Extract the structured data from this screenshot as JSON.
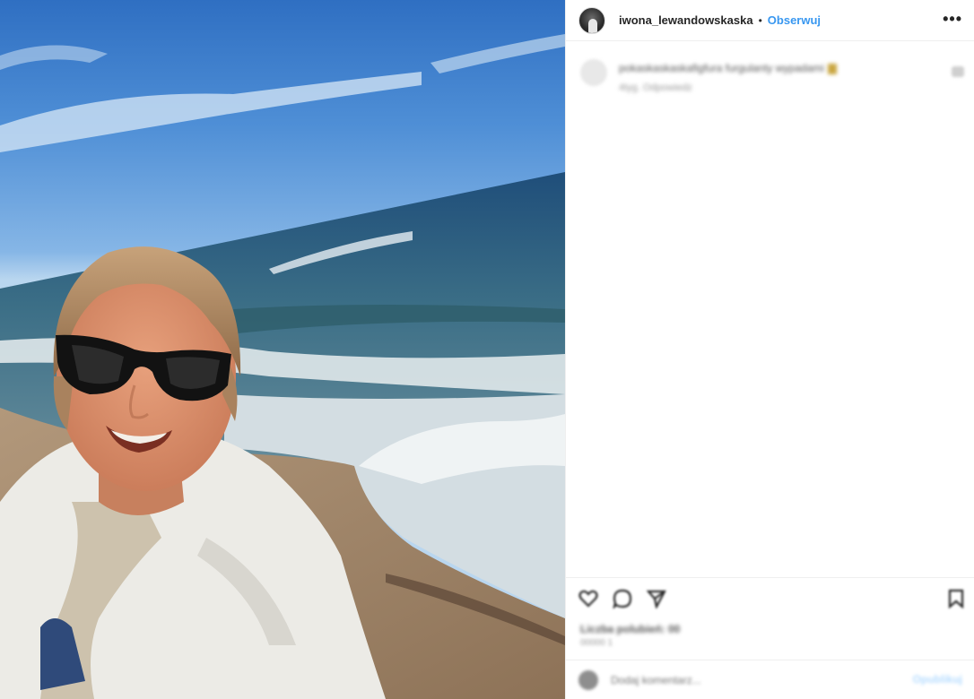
{
  "post": {
    "username": "iwona_lewandowskaska",
    "separator": "•",
    "follow_label": "Obserwuj",
    "more_label": "•••",
    "caption": {
      "text": "pokaskaskaskafigfura furgulanty wypadami",
      "meta": "4tyg.   Odpowiedz"
    },
    "likes_text": "Liczba polubień: 00",
    "date_text": "00000 1",
    "comment_placeholder": "Dodaj komentarz...",
    "publish_label": "Opublikuj"
  },
  "icons": {
    "more": "more-options-icon",
    "like": "heart-icon",
    "comment": "comment-icon",
    "share": "share-icon",
    "save": "bookmark-icon",
    "emoji": "emoji-icon",
    "caption_like": "small-heart-icon"
  },
  "colors": {
    "accent": "#3897f0",
    "text": "#262626",
    "border": "#efefef"
  }
}
